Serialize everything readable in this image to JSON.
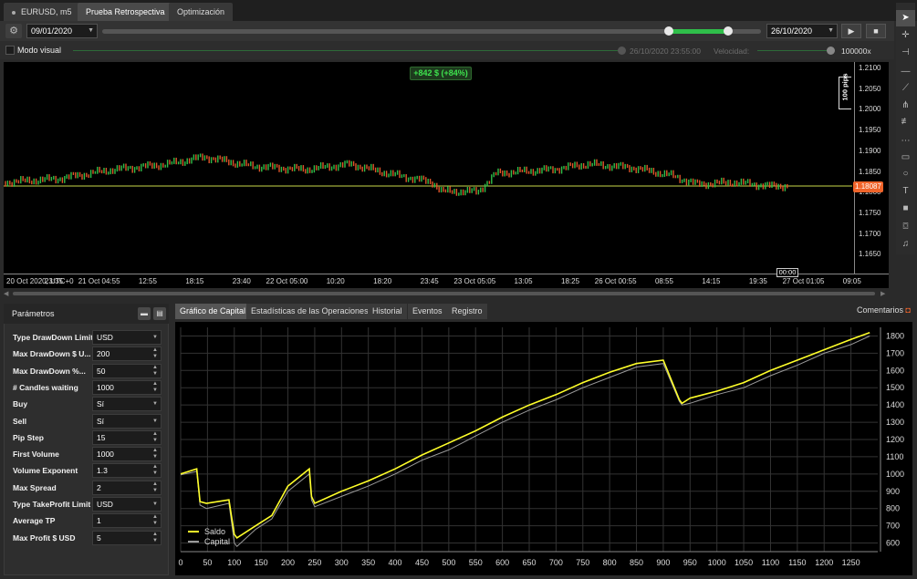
{
  "tabs": [
    {
      "label": "EURUSD, m5"
    },
    {
      "label": "Prueba Retrospectiva"
    },
    {
      "label": "Optimización"
    }
  ],
  "controls": {
    "start_date": "09/01/2020",
    "end_date": "26/10/2020",
    "range_start_fraction": 0.86,
    "range_end_fraction": 0.95,
    "play_icon": "play-icon",
    "stop_icon": "stop-icon"
  },
  "visual_mode": {
    "label": "Modo visual",
    "current_time": "26/10/2020 23:55:00",
    "speed_label": "Velocidad:",
    "speed_value": "100000x"
  },
  "price_chart": {
    "profit_badge": "+842 $ (+84%)",
    "pips_label": "100 pips",
    "current_price": "1.18087",
    "cursor_time": "00:00",
    "y_ticks": [
      "1.2100",
      "1.2050",
      "1.2000",
      "1.1950",
      "1.1900",
      "1.1850",
      "1.1800",
      "1.1750",
      "1.1700",
      "1.1650"
    ],
    "x_ticks": [
      "20 Oct 2020, UTC+0",
      "23:35",
      "21 Oct 04:55",
      "12:55",
      "18:15",
      "23:40",
      "22 Oct 05:00",
      "10:20",
      "18:20",
      "23:45",
      "23 Oct 05:05",
      "13:05",
      "18:25",
      "26 Oct 00:55",
      "08:55",
      "14:15",
      "19:35",
      "27 Oct 01:05",
      "09:05"
    ],
    "colors": {
      "up": "#2fbf4a",
      "down": "#e0562a",
      "line": "#c8d84a",
      "badge_bg": "#1d3a1d",
      "badge_text": "#3ee24e",
      "price_tag": "#f0642a"
    }
  },
  "params": {
    "title": "Parámetros",
    "rows": [
      {
        "name": "Type DrawDown Limit",
        "value": "USD",
        "kind": "select"
      },
      {
        "name": "Max DrawDown $ U...",
        "value": "200",
        "kind": "spin"
      },
      {
        "name": "Max DrawDown %...",
        "value": "50",
        "kind": "spin"
      },
      {
        "name": "# Candles waiting",
        "value": "1000",
        "kind": "spin"
      },
      {
        "name": "Buy",
        "value": "Sí",
        "kind": "select"
      },
      {
        "name": "Sell",
        "value": "Sí",
        "kind": "select"
      },
      {
        "name": "Pip Step",
        "value": "15",
        "kind": "spin"
      },
      {
        "name": "First Volume",
        "value": "1000",
        "kind": "spin"
      },
      {
        "name": "Volume Exponent",
        "value": "1.3",
        "kind": "spin"
      },
      {
        "name": "Max Spread",
        "value": "2",
        "kind": "spin"
      },
      {
        "name": "Type TakeProfit Limit",
        "value": "USD",
        "kind": "select"
      },
      {
        "name": "Average TP",
        "value": "1",
        "kind": "spin"
      },
      {
        "name": "Max Profit $ USD",
        "value": "5",
        "kind": "spin"
      }
    ]
  },
  "bottom_tabs": [
    {
      "label": "Gráfico de Capital"
    },
    {
      "label": "Estadísticas de las Operaciones"
    },
    {
      "label": "Historial"
    },
    {
      "label": "Eventos"
    },
    {
      "label": "Registro"
    }
  ],
  "comments_label": "Comentarios",
  "chart_data": {
    "type": "line",
    "xlim": [
      0,
      1300
    ],
    "ylim": [
      550,
      1850
    ],
    "x_ticks": [
      0,
      50,
      100,
      150,
      200,
      250,
      300,
      350,
      400,
      450,
      500,
      550,
      600,
      650,
      700,
      750,
      800,
      850,
      900,
      950,
      1000,
      1050,
      1100,
      1150,
      1200,
      1250
    ],
    "y_ticks": [
      600,
      700,
      800,
      900,
      1000,
      1100,
      1200,
      1300,
      1400,
      1500,
      1600,
      1700,
      1800
    ],
    "series": [
      {
        "name": "Saldo",
        "color": "#ffff2a",
        "x": [
          0,
          30,
          36,
          48,
          90,
          100,
          105,
          140,
          170,
          200,
          240,
          244,
          250,
          300,
          350,
          400,
          450,
          500,
          550,
          600,
          650,
          700,
          750,
          800,
          850,
          900,
          930,
          935,
          950,
          1000,
          1050,
          1100,
          1150,
          1200,
          1250,
          1285
        ],
        "y": [
          1000,
          1030,
          840,
          830,
          850,
          650,
          630,
          700,
          760,
          930,
          1030,
          870,
          830,
          900,
          960,
          1030,
          1110,
          1180,
          1250,
          1330,
          1400,
          1460,
          1530,
          1590,
          1640,
          1660,
          1430,
          1410,
          1440,
          1480,
          1530,
          1600,
          1660,
          1720,
          1780,
          1820
        ]
      },
      {
        "name": "Capital",
        "color": "#9a9a9a",
        "x": [
          0,
          30,
          36,
          48,
          90,
          100,
          105,
          140,
          170,
          200,
          240,
          244,
          250,
          300,
          350,
          400,
          450,
          500,
          550,
          600,
          650,
          700,
          750,
          800,
          850,
          900,
          930,
          935,
          950,
          1000,
          1050,
          1100,
          1150,
          1200,
          1250,
          1285
        ],
        "y": [
          995,
          1015,
          820,
          800,
          830,
          600,
          580,
          680,
          740,
          900,
          1000,
          850,
          810,
          870,
          930,
          1000,
          1080,
          1140,
          1220,
          1300,
          1370,
          1430,
          1500,
          1560,
          1620,
          1640,
          1420,
          1400,
          1410,
          1460,
          1500,
          1570,
          1630,
          1700,
          1750,
          1800
        ]
      }
    ],
    "legend": "bottom-left"
  }
}
